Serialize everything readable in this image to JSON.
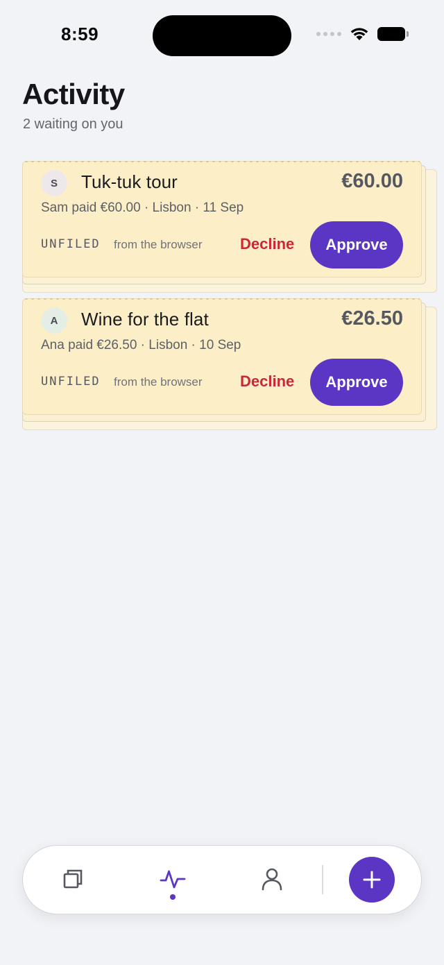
{
  "status_bar": {
    "time": "8:59"
  },
  "header": {
    "title": "Activity",
    "subtitle": "2 waiting on you"
  },
  "requests": [
    {
      "initial": "S",
      "title": "Tuk-tuk tour",
      "amount": "€60.00",
      "meta": "Sam paid €60.00 · Lisbon · 11 Sep",
      "tag": "UNFILED",
      "source": "from the browser",
      "decline_label": "Decline",
      "approve_label": "Approve"
    },
    {
      "initial": "A",
      "title": "Wine for the flat",
      "amount": "€26.50",
      "meta": "Ana paid €26.50 · Lisbon · 10 Sep",
      "tag": "UNFILED",
      "source": "from the browser",
      "decline_label": "Decline",
      "approve_label": "Approve"
    }
  ],
  "tabbar": {
    "tabs": [
      {
        "icon": "cards-icon",
        "active": false
      },
      {
        "icon": "activity-icon",
        "active": true
      },
      {
        "icon": "profile-icon",
        "active": false
      }
    ],
    "fab_icon": "plus-icon"
  },
  "colors": {
    "accent": "#5b35c4",
    "decline": "#c8283a",
    "card_background": "#fcefc8",
    "page_background": "#f2f3f7"
  }
}
